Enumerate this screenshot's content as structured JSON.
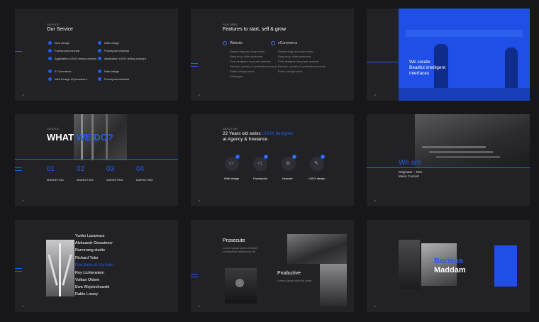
{
  "s1": {
    "title": "Our Service",
    "col1": [
      "Web design",
      "Powerpoint minimal",
      "Application UI/UX during concept"
    ],
    "col2": [
      "Web design",
      "Powerpoint minimal",
      "Application UI/UX during concept"
    ],
    "col3": [
      "E-Commerce",
      "Web Design UI prominent"
    ],
    "col4": [
      "Web design",
      "Powerpoint minimal"
    ]
  },
  "s2": {
    "title": "Features to start, sell & grow",
    "h1": "Website",
    "h2": "eCommerce",
    "l1": [
      "Simple drag and drop editor",
      "Drag drop, slide geoframe",
      "Free designed recourse systems",
      "Domain, corners & professional email",
      "Editor backgrounds",
      "Edit pages"
    ],
    "l2": [
      "Simple drag and drop editor",
      "Drag drop, slide geoframe",
      "Free designed recourse systems",
      "Domain, corners & professional email",
      "Editor backgrounds"
    ]
  },
  "s3": {
    "line1": "We create",
    "line2": "Beatiful intelligent",
    "line3": "interfaces"
  },
  "s4": {
    "title_a": "WHAT ",
    "title_b": "WE DO?",
    "nums": [
      "01",
      "02",
      "03",
      "04"
    ],
    "label": "MARKETING"
  },
  "s5": {
    "line1a": "22 Years old swiss ",
    "line1b": "UI/UX designer",
    "line2": "at Agency & freelance",
    "items": [
      "Web design",
      "Powerpoint",
      "Keynote",
      "UI/UX design"
    ],
    "badges": [
      "1",
      "2",
      "3",
      "4"
    ]
  },
  "s6": {
    "title": "We are",
    "sub1": "Originator – Rick",
    "sub2": "Music Concert"
  },
  "s7": {
    "names": [
      "Yuriko Lavamura",
      "Aleksandr Gerasimov",
      "Rumerang studio",
      "Richard Yoko",
      "Red Safari & Lily Arbu",
      "Roy Lichtenstein",
      "Volkan Oktem",
      "Ewa Wojciechowski",
      "Rablo Lossry"
    ]
  },
  "s8": {
    "title1": "Prosecute",
    "title2": "Productive"
  },
  "s9": {
    "word1": "Borisos",
    "word2": "Maddam"
  },
  "colors": {
    "accent": "#1f5ff0",
    "slide_bg": "#222226",
    "page_bg": "#171719"
  }
}
